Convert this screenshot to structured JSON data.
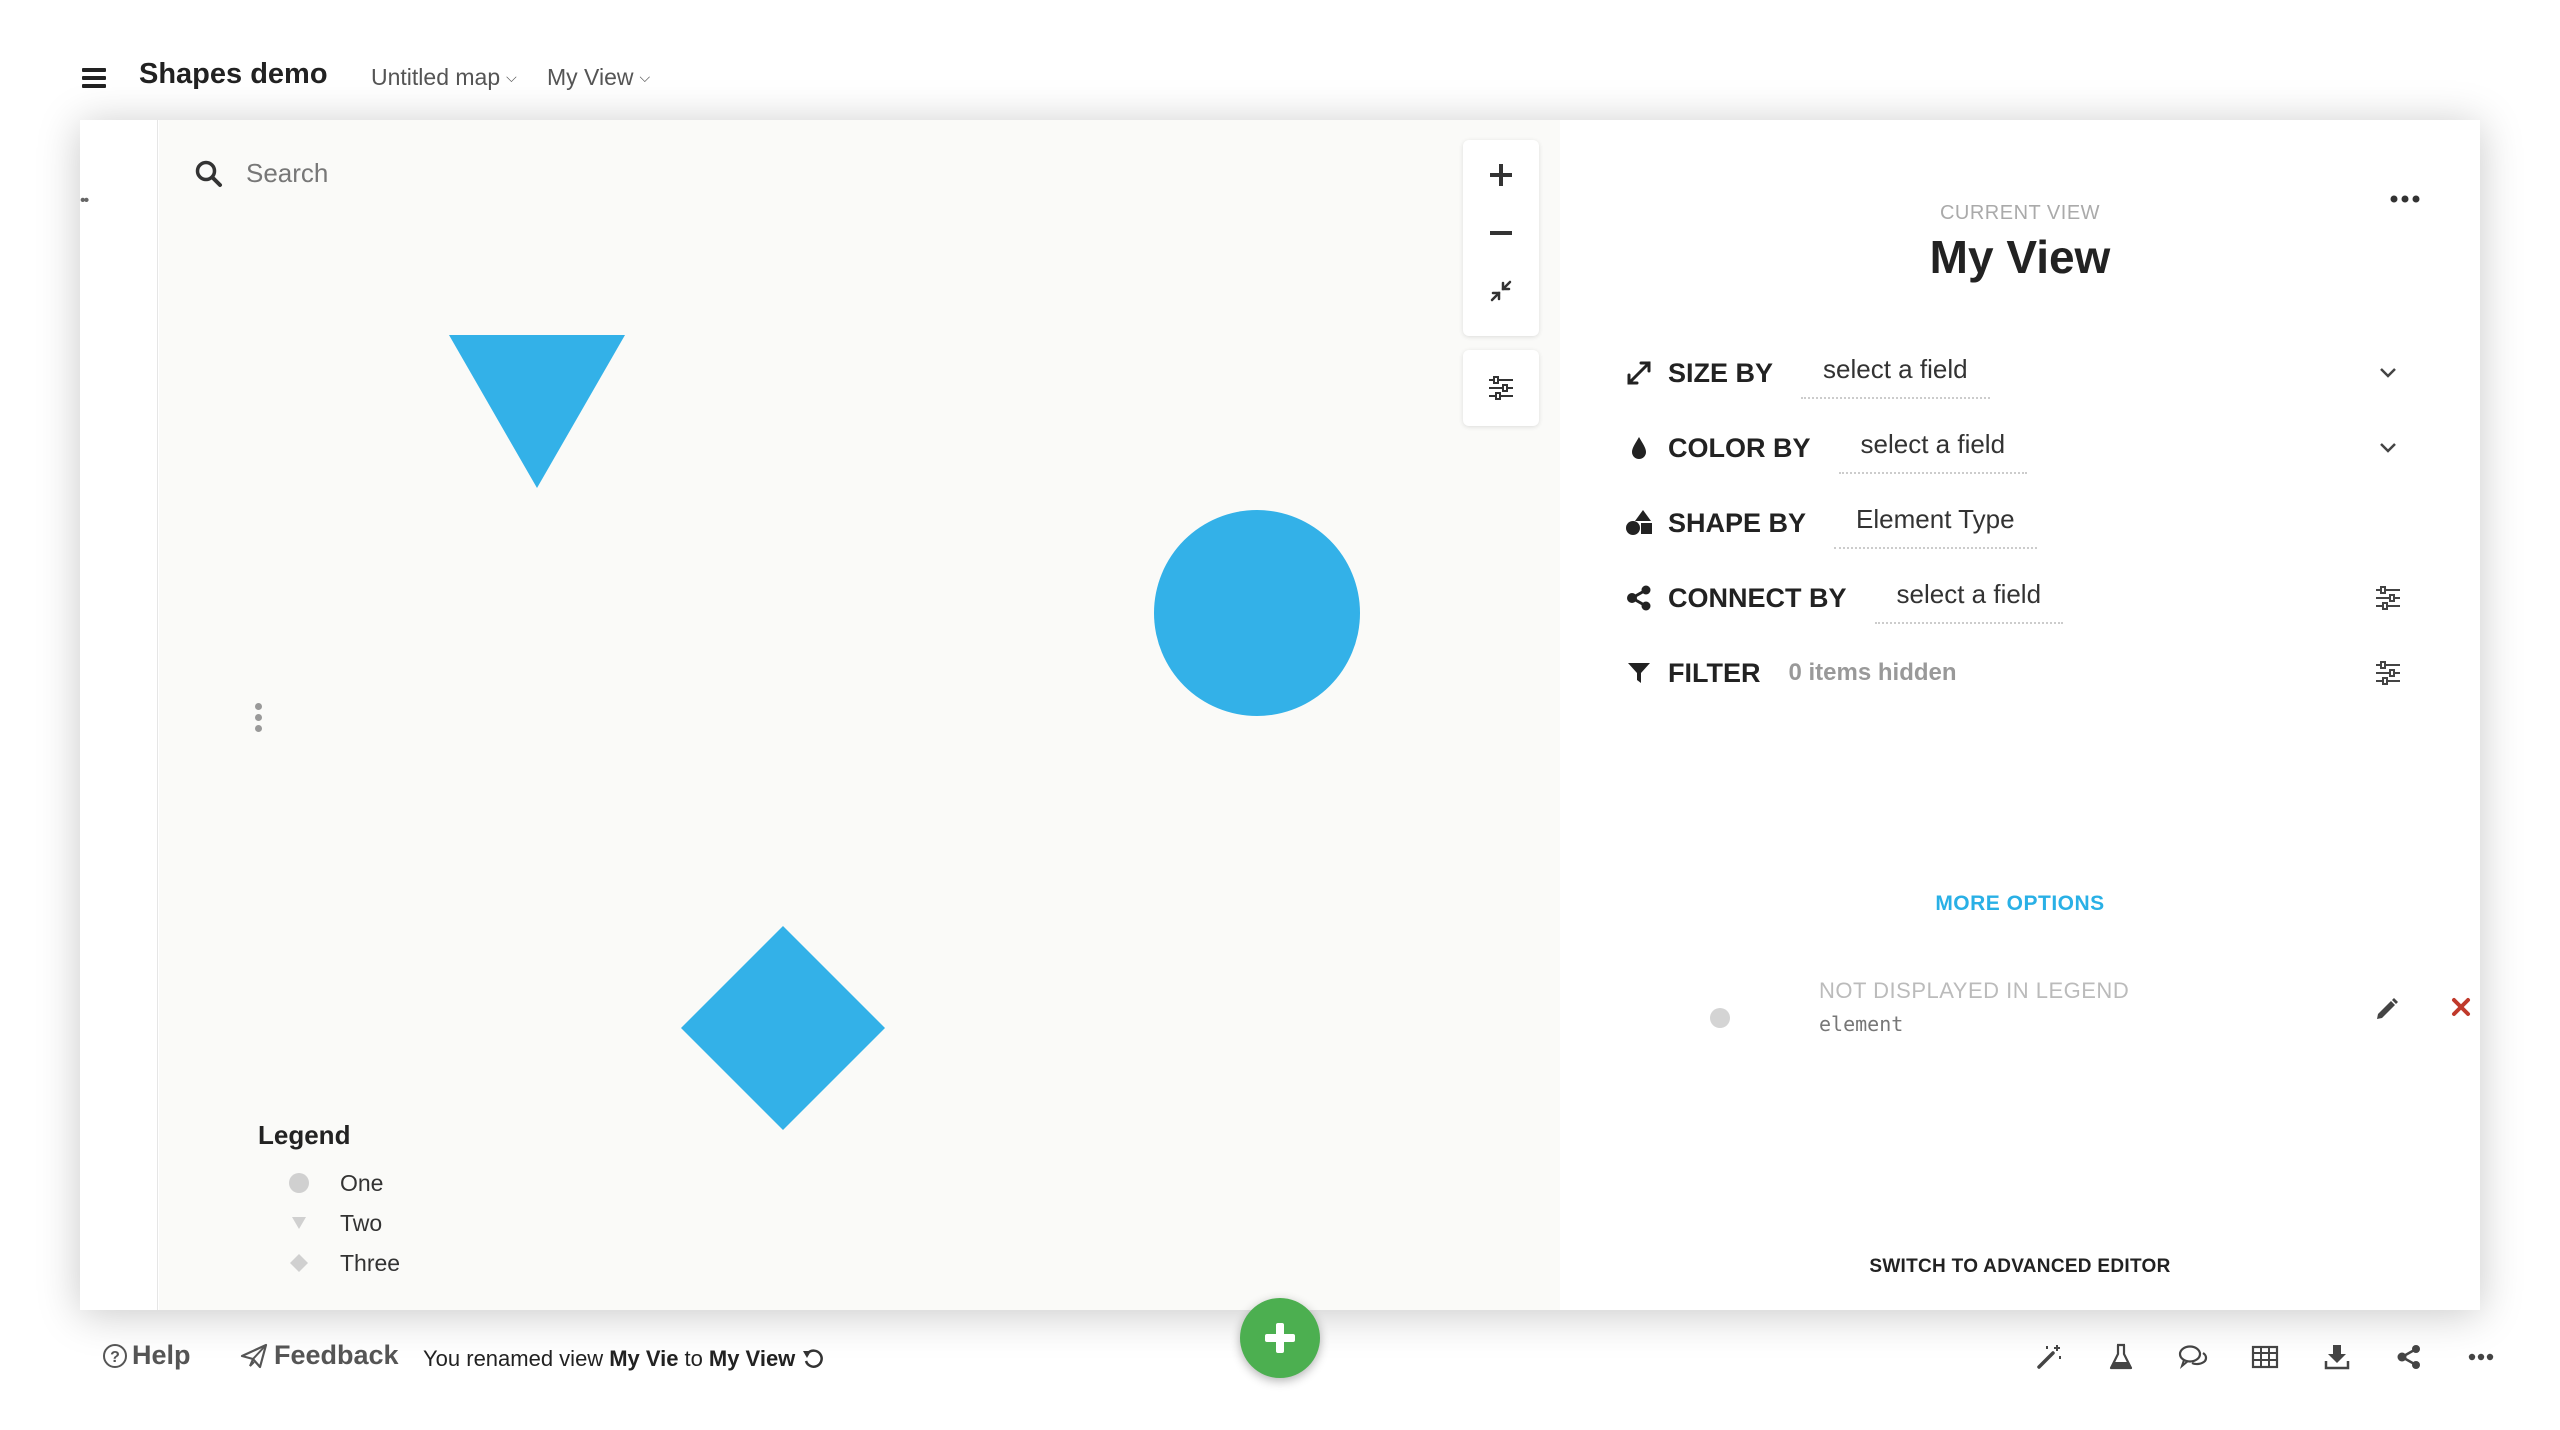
{
  "header": {
    "app_title": "Shapes demo",
    "map_name": "Untitled map",
    "view_name": "My View"
  },
  "canvas": {
    "search_placeholder": "Search",
    "shapes": [
      {
        "type": "triangle-down",
        "color": "#33b1e8"
      },
      {
        "type": "circle",
        "color": "#33b1e8"
      },
      {
        "type": "diamond",
        "color": "#33b1e8"
      }
    ],
    "legend": {
      "title": "Legend",
      "items": [
        {
          "label": "One",
          "symbol": "circle"
        },
        {
          "label": "Two",
          "symbol": "triangle-down"
        },
        {
          "label": "Three",
          "symbol": "diamond"
        }
      ]
    }
  },
  "panel": {
    "current_view_label": "CURRENT VIEW",
    "view_title": "My View",
    "size_by": {
      "label": "SIZE BY",
      "value": "select a field"
    },
    "color_by": {
      "label": "COLOR BY",
      "value": "select a field"
    },
    "shape_by": {
      "label": "SHAPE BY",
      "value": "Element Type"
    },
    "connect_by": {
      "label": "CONNECT BY",
      "value": "select a field"
    },
    "filter": {
      "label": "FILTER",
      "value": "0 items hidden"
    },
    "more_options": "MORE OPTIONS",
    "legend_entry": {
      "label": "NOT DISPLAYED IN LEGEND",
      "sub": "element"
    },
    "switch_editor": "SWITCH TO ADVANCED EDITOR"
  },
  "footer": {
    "help": "Help",
    "feedback": "Feedback",
    "status_prefix": "You renamed view",
    "status_old": "My Vie",
    "status_mid": "to",
    "status_new": "My View"
  },
  "colors": {
    "accent": "#29b0e6",
    "shape": "#33b1e8",
    "fab": "#4caf50",
    "delete": "#c0392b"
  }
}
